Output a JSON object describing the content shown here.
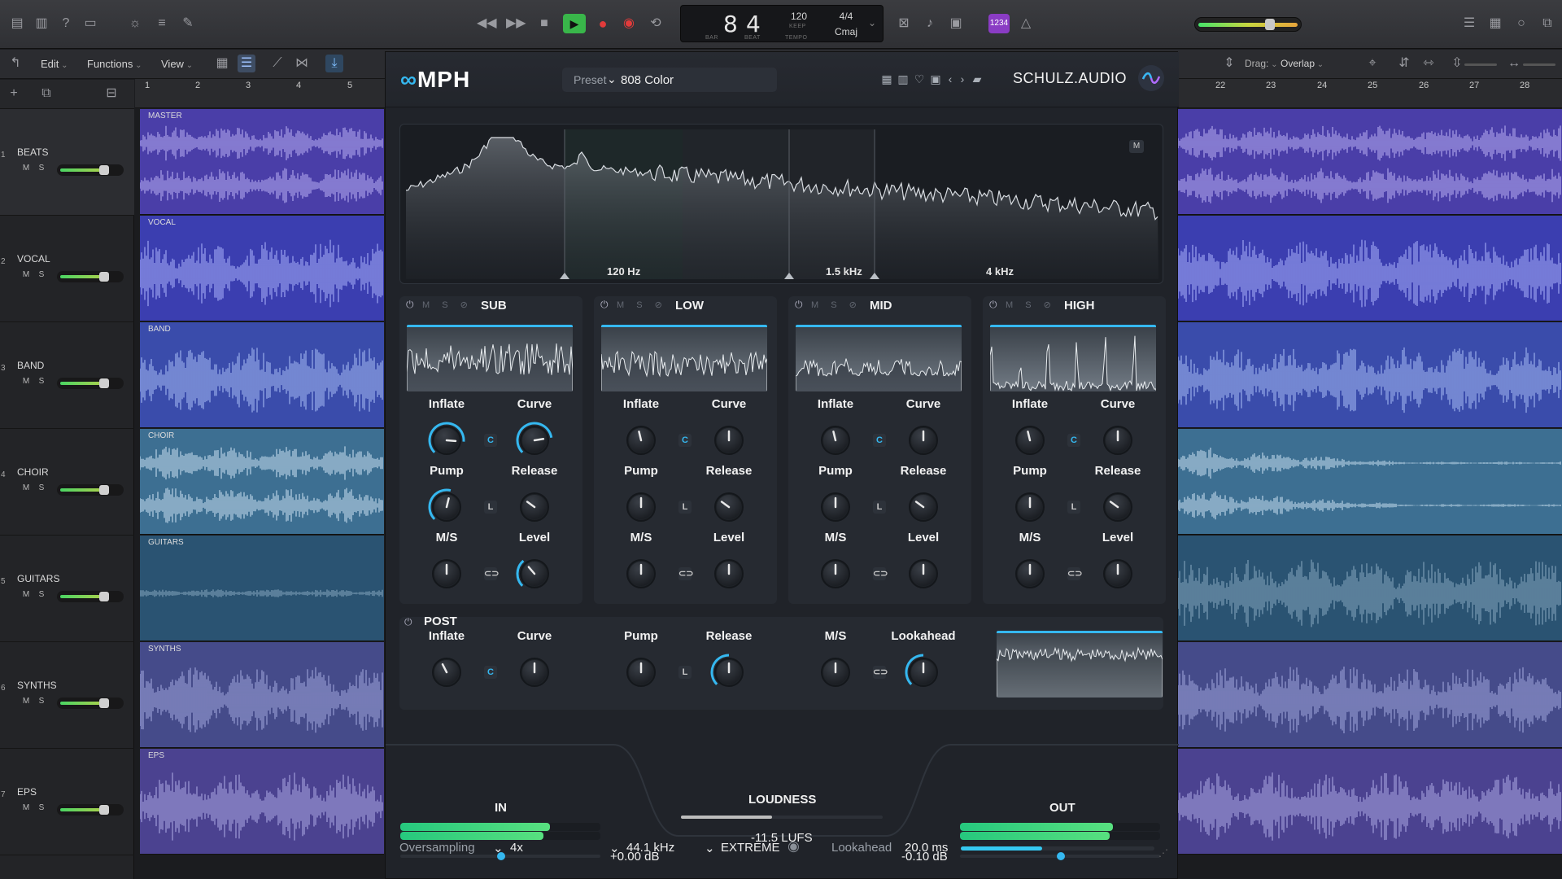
{
  "lcd": {
    "bar": "8",
    "beat": "4",
    "bar_lbl": "BAR",
    "beat_lbl": "BEAT",
    "tempo": "120",
    "keep": "KEEP",
    "tempo_lbl": "TEMPO",
    "sig": "4/4",
    "key": "Cmaj"
  },
  "badge_1234": "1234",
  "secbar": {
    "edit": "Edit",
    "functions": "Functions",
    "view": "View",
    "drag_label": "Drag:",
    "drag_value": "Overlap"
  },
  "ruler_left": [
    "1",
    "2",
    "3",
    "4",
    "5"
  ],
  "ruler_right": [
    "22",
    "23",
    "24",
    "25",
    "26",
    "27",
    "28"
  ],
  "tracks": [
    {
      "num": "1",
      "name": "BEATS",
      "region": "MASTER",
      "m": "M",
      "s": "S"
    },
    {
      "num": "2",
      "name": "VOCAL",
      "region": "VOCAL",
      "m": "M",
      "s": "S"
    },
    {
      "num": "3",
      "name": "BAND",
      "region": "BAND",
      "m": "M",
      "s": "S"
    },
    {
      "num": "4",
      "name": "CHOIR",
      "region": "CHOIR",
      "m": "M",
      "s": "S"
    },
    {
      "num": "5",
      "name": "GUITARS",
      "region": "GUITARS",
      "m": "M",
      "s": "S"
    },
    {
      "num": "6",
      "name": "SYNTHS",
      "region": "SYNTHS",
      "m": "M",
      "s": "S"
    },
    {
      "num": "7",
      "name": "EPS",
      "region": "EPS",
      "m": "M",
      "s": "S"
    }
  ],
  "plugin": {
    "logo": "MPH",
    "preset_label": "Preset",
    "preset_value": "808 Color",
    "brand": "SCHULZ.AUDIO",
    "m_badge": "M",
    "crossovers": [
      "120 Hz",
      "1.5 kHz",
      "4 kHz"
    ],
    "bands": [
      {
        "name": "SUB"
      },
      {
        "name": "LOW"
      },
      {
        "name": "MID"
      },
      {
        "name": "HIGH"
      }
    ],
    "knob_labels": {
      "inflate": "Inflate",
      "curve": "Curve",
      "pump": "Pump",
      "release": "Release",
      "ms": "M/S",
      "level": "Level",
      "lookahead": "Lookahead"
    },
    "c_badge": "C",
    "l_badge": "L",
    "post": "POST",
    "in_label": "IN",
    "out_label": "OUT",
    "loudness_label": "LOUDNESS",
    "loudness_value": "-11.5 LUFS",
    "in_gain": "+0.00 dB",
    "out_gain": "-0.10 dB",
    "footer": {
      "oversampling_label": "Oversampling",
      "oversampling_value": "4x",
      "sample_rate": "44.1 kHz",
      "mode": "EXTREME",
      "lookahead_label": "Lookahead",
      "lookahead_value": "20.0 ms"
    }
  }
}
